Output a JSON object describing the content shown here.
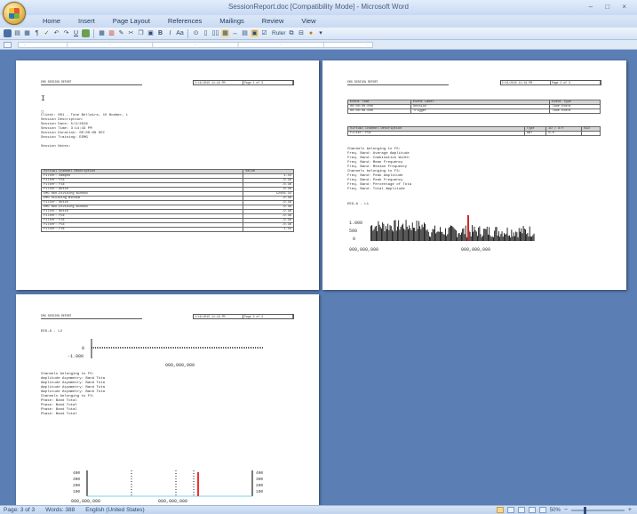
{
  "window": {
    "title": "SessionReport.doc [Compatibility Mode] - Microsoft Word",
    "controls": "– □ ×"
  },
  "ribbon": {
    "tabs": [
      "Home",
      "Insert",
      "Page Layout",
      "References",
      "Mailings",
      "Review",
      "View"
    ]
  },
  "toolbar": {
    "ruler_label": "Ruler"
  },
  "pages": {
    "p1": {
      "header_left": "EMG SESSION REPORT",
      "header_right": [
        "2/19/2015 11:19 PM",
        "Page 1 of 3"
      ],
      "cursor": "I",
      "lines": [
        "Client: 001 - Tone Bellaire, 15 Bodmer, L",
        "Session Description:",
        "Session Date: 5/4/2016",
        "Session Time: 3:14:43 PM",
        "Session Duration: 00:00:08 SEC",
        "Session Training: EEMG",
        "",
        "Session Notes:"
      ],
      "table_headers": [
        "Virtual Channel Description",
        "Value"
      ],
      "table_rows": [
        [
          "Filter: Damped",
          "1.44"
        ],
        [
          "Filter: F5E",
          "-0.36"
        ],
        [
          "Filter: F3E",
          "-0.36"
        ],
        [
          "Filter: Notch",
          "-0.36"
        ],
        [
          "EMG Non-Dividing Window",
          "12456.34"
        ],
        [
          "EMG Dividing Window",
          "-0.36"
        ],
        [
          "Filter: Notch",
          "-0.36"
        ],
        [
          "EMG Non-Dividing Window",
          "-0.36"
        ],
        [
          "Filter: Notch",
          "-0.36"
        ],
        [
          "Filter: F5E",
          "-0.36"
        ],
        [
          "Filter: F3E",
          "-0.36"
        ],
        [
          "Filter: F5E",
          "-0.36"
        ],
        [
          "Filter: F3E",
          "1.44"
        ]
      ]
    },
    "p2": {
      "header_left": "EMG SESSION REPORT",
      "header_right": [
        "2/19/2015 11:19 PM",
        "Page 2 of 3"
      ],
      "event_headers": [
        "Event Time",
        "Event Label",
        "Event Type"
      ],
      "event_rows": [
        [
          "00:00:00.000",
          "Session",
          "Time Event"
        ],
        [
          "00:00:08.000",
          "Trigger",
          "Time Event"
        ]
      ],
      "channel_headers": [
        "Virtual Channel Description",
        "Type",
        "ID / X/Y",
        "BID"
      ],
      "channel_rows": [
        [
          "Filter: F5E",
          "ABT",
          "0.0",
          ""
        ]
      ],
      "stats_lines": [
        "Channels belonging to F5:",
        "   Freq. Band: Average Amplitude",
        "   Freq. Band: Combination Width",
        "   Freq. Band: Mean Frequency",
        "   Freq. Band: Median Frequency",
        "Channels belonging to F3:",
        "   Freq. Band: Peak Amplitude",
        "   Freq. Band: Peak Frequency",
        "   Freq. Band: Percentage of Tota",
        "   Freq. Band: Total Amplitude"
      ],
      "chart_title": "EEG-A - L1",
      "y_ticks": [
        "1.000",
        "500",
        "0"
      ],
      "x_ticks": [
        "000,000,000",
        "000,000,000"
      ]
    },
    "p3": {
      "header_left": "EMG SESSION REPORT",
      "header_right": [
        "2/19/2015 11:19 PM",
        "Page 3 of 3"
      ],
      "chart_title": "EEG-A - L2",
      "y_ticks": [
        "0",
        "-1.000"
      ],
      "x_tick": "000,000,000",
      "stats_lines": [
        "Channels belonging to F5:",
        "   Amplitude Asymmetry: Band Tota",
        "   Amplitude Asymmetry: Band Tota",
        "   Amplitude Asymmetry: Band Tota",
        "   Amplitude Asymmetry: Band Tota",
        "Channels belonging to F3:",
        "   Phase: Band Total",
        "   Phase: Band Total",
        "   Phase: Band Total",
        "   Phase: Band Total"
      ],
      "bar_y_ticks": [
        "400",
        "300",
        "200",
        "100",
        "0"
      ],
      "bar_x_ticks": [
        "000,000,000",
        "000,000,000"
      ]
    }
  },
  "status": {
    "page": "Page: 3 of 3",
    "words": "Words: 388",
    "language": "English (United States)",
    "zoom": "50%"
  }
}
